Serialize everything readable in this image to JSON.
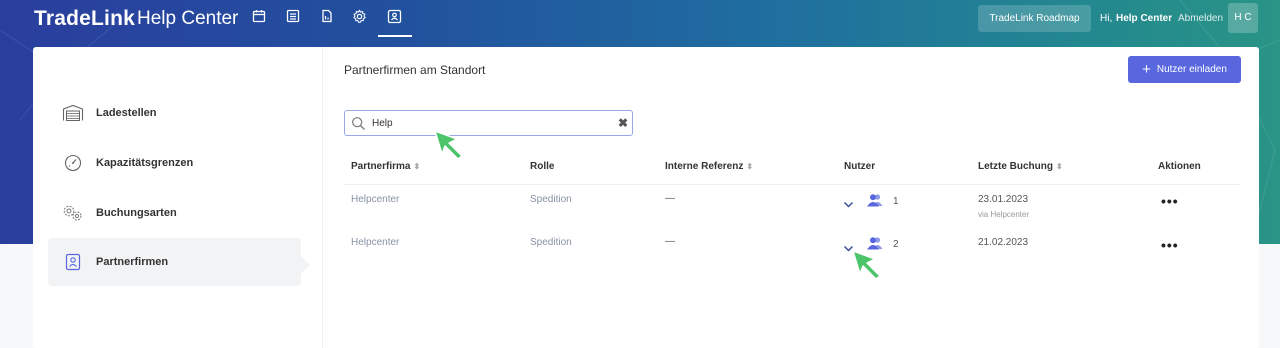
{
  "header": {
    "logo": "TradeLink",
    "subtitle": "Help Center",
    "nav_icons": [
      "calendar-icon",
      "list-icon",
      "document-icon",
      "gear-icon",
      "contact-card-icon"
    ],
    "roadmap_label": "TradeLink Roadmap",
    "greeting": "Hi,",
    "user_name": "Help Center",
    "logout_label": "Abmelden",
    "avatar_initials": "H C"
  },
  "sidebar": {
    "items": [
      {
        "label": "Ladestellen",
        "icon": "loading-dock-icon"
      },
      {
        "label": "Kapazitätsgrenzen",
        "icon": "gauge-icon"
      },
      {
        "label": "Buchungsarten",
        "icon": "gears-icon"
      },
      {
        "label": "Partnerfirmen",
        "icon": "contact-card-icon",
        "active": true
      }
    ]
  },
  "main": {
    "title": "Partnerfirmen am Standort",
    "invite_label": "Nutzer einladen",
    "search_value": "Help",
    "columns": [
      "Partnerfirma",
      "Rolle",
      "Interne Referenz",
      "Nutzer",
      "Letzte Buchung",
      "Aktionen"
    ],
    "rows": [
      {
        "company": "Helpcenter",
        "role": "Spedition",
        "reference": "—",
        "users": "1",
        "last_booking": "23.01.2023",
        "booking_note": "via Helpcenter",
        "actions": "•••"
      },
      {
        "company": "Helpcenter",
        "role": "Spedition",
        "reference": "—",
        "users": "2",
        "last_booking": "21.02.2023",
        "booking_note": "",
        "actions": "•••"
      }
    ]
  },
  "colors": {
    "accent": "#5867dd",
    "hero_start": "#2a3e9e",
    "hero_end": "#2a9486",
    "cursor": "#4cc46a"
  }
}
